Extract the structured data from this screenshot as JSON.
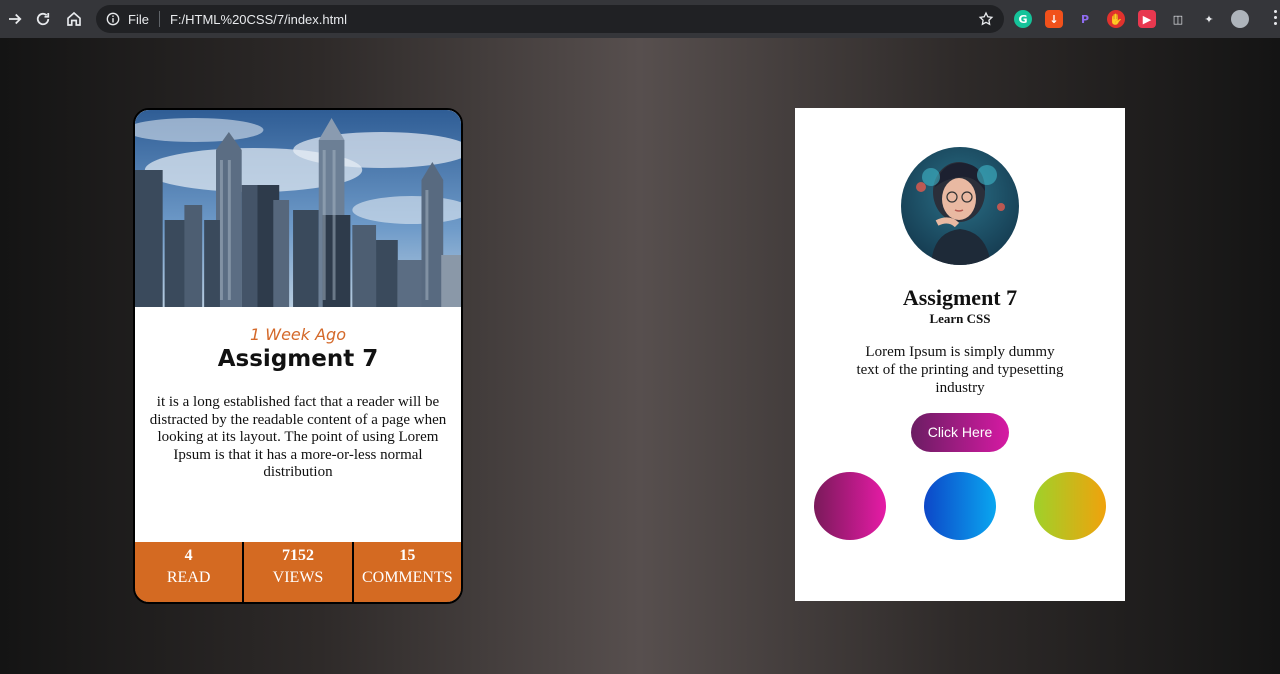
{
  "browser": {
    "file_label": "File",
    "url": "F:/HTML%20CSS/7/index.html",
    "extensions": [
      {
        "name": "grammarly",
        "letter": "G",
        "color": "#15c39a"
      },
      {
        "name": "download",
        "letter": "↓",
        "color": "#f1511b"
      },
      {
        "name": "extension-p",
        "letter": "P",
        "color": "#6a3fd1"
      },
      {
        "name": "hand",
        "letter": "✋",
        "color": "#e0322d"
      },
      {
        "name": "play",
        "letter": "▶",
        "color": "#e8384f"
      },
      {
        "name": "screen",
        "letter": "◫",
        "color": "#9aa0a6"
      },
      {
        "name": "puzzle",
        "letter": "✦",
        "color": "#9aa0a6"
      }
    ]
  },
  "left_card": {
    "time": "1 Week Ago",
    "title": "Assigment 7",
    "text": "it is a long established fact that a reader will be distracted by the readable content of a page when looking at its layout. The point of using Lorem Ipsum is that it has a more-or-less normal distribution",
    "stats": [
      {
        "num": "4",
        "label": "READ"
      },
      {
        "num": "7152",
        "label": "VIEWS"
      },
      {
        "num": "15",
        "label": "COMMENTS"
      }
    ]
  },
  "right_card": {
    "title": "Assigment 7",
    "subtitle": "Learn CSS",
    "text": "Lorem Ipsum is simply dummy text of the printing and typesetting industry",
    "button": "Click Here"
  },
  "colors": {
    "accent_orange": "#d46a22",
    "time_orange": "#d4692a"
  }
}
